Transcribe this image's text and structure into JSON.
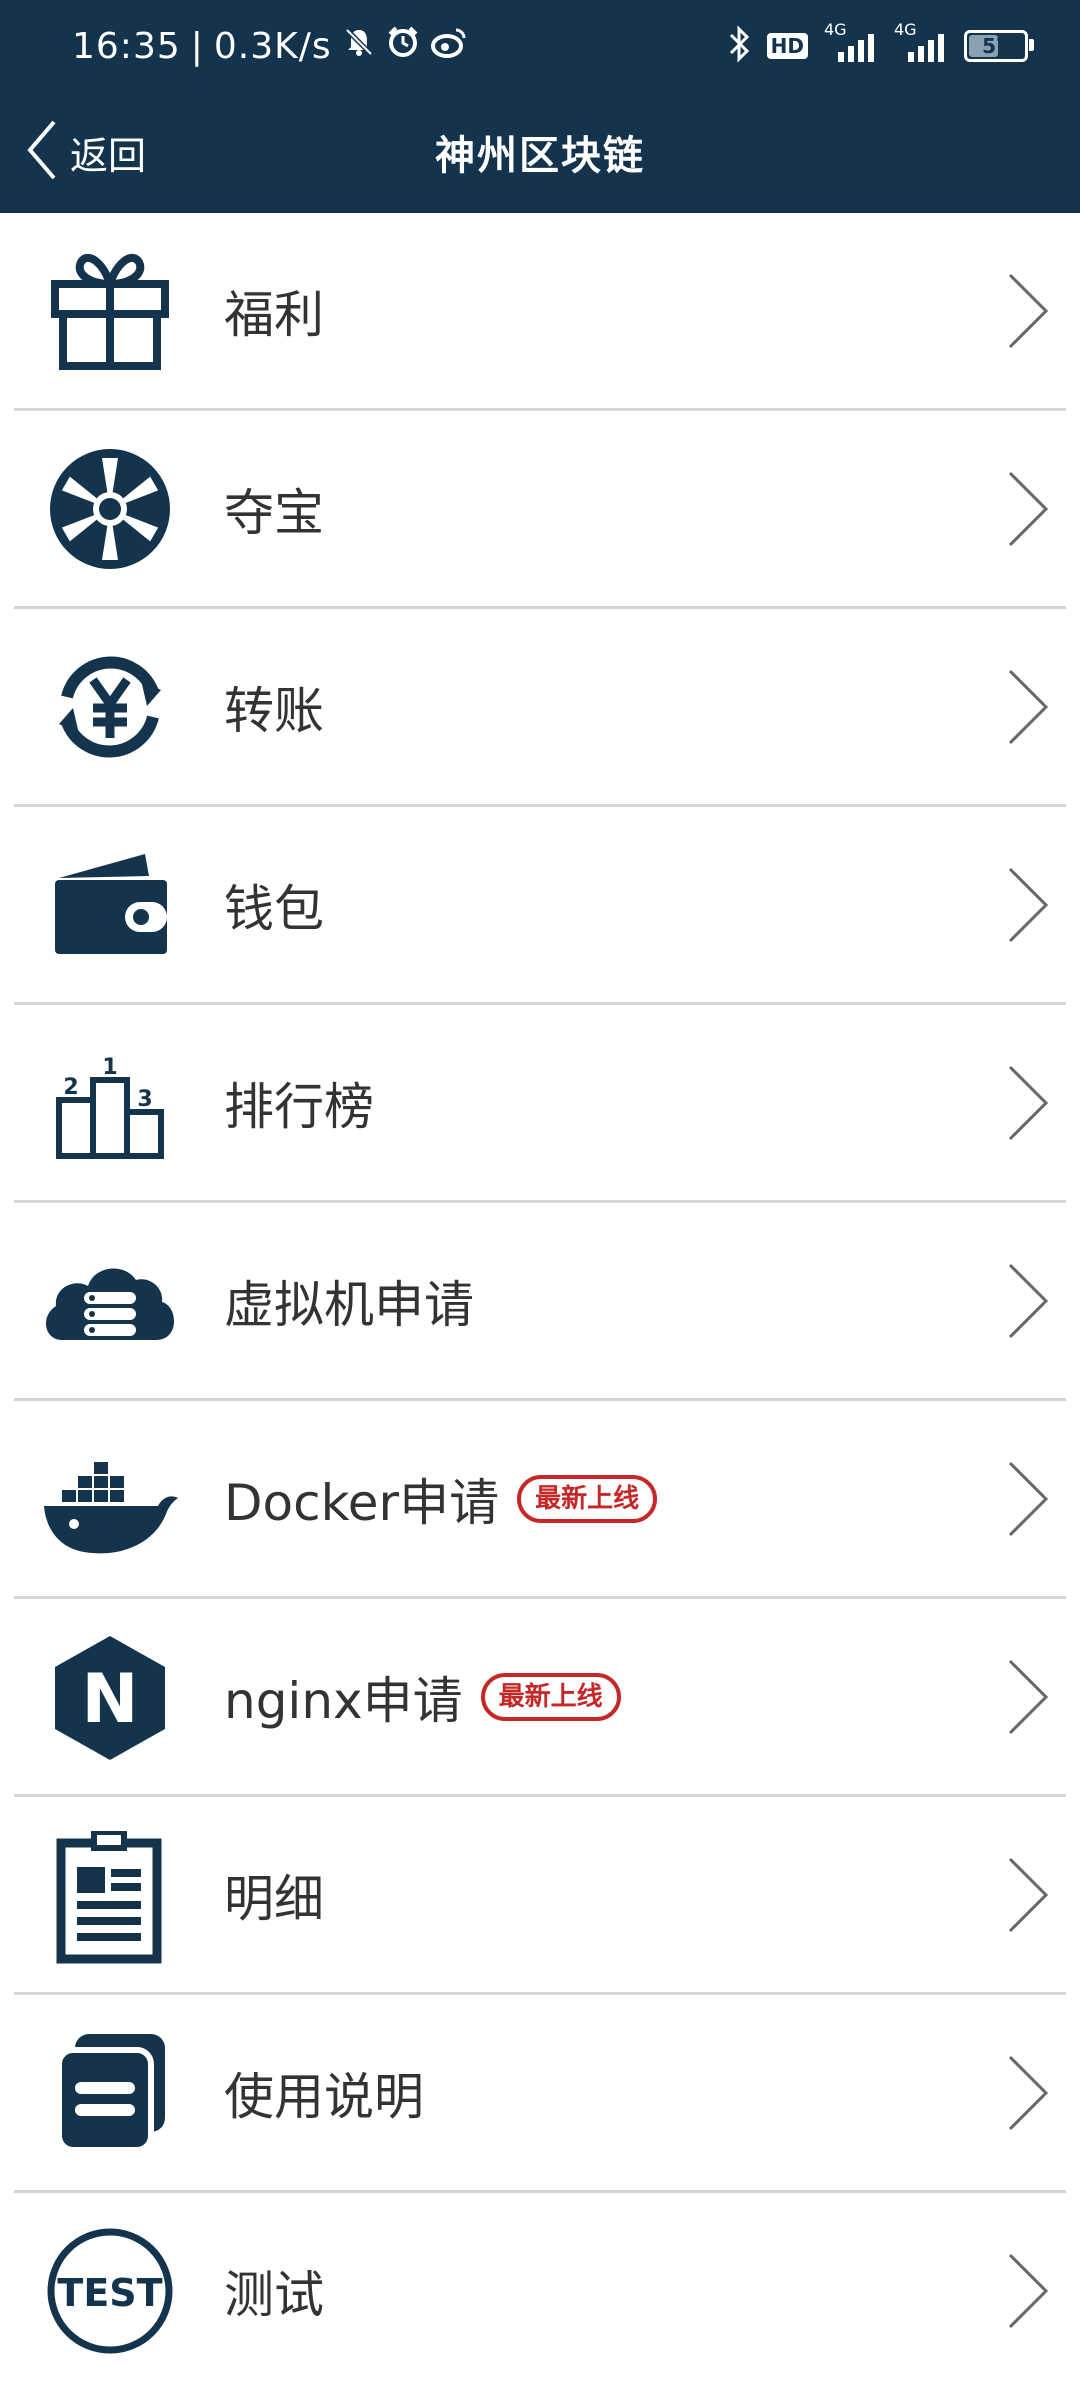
{
  "status_bar": {
    "time": "16:35",
    "speed": "0.3K/s",
    "left_icons": [
      "mute-icon",
      "alarm-icon",
      "weibo-icon"
    ],
    "network1": "4G",
    "network2": "4G",
    "hd": "HD",
    "battery": "57",
    "battery_level": 0.57
  },
  "header": {
    "back_label": "返回",
    "title": "神州区块链"
  },
  "colors": {
    "brand": "#14334d",
    "badge_red": "#c62828",
    "divider": "#d6d6d6"
  },
  "menu": [
    {
      "label": "福利",
      "icon": "gift-icon"
    },
    {
      "label": "夺宝",
      "icon": "wheel-icon"
    },
    {
      "label": "转账",
      "icon": "yen-transfer-icon"
    },
    {
      "label": "钱包",
      "icon": "wallet-icon"
    },
    {
      "label": "排行榜",
      "icon": "podium-icon",
      "podium": [
        "2",
        "1",
        "3"
      ]
    },
    {
      "label": "虚拟机申请",
      "icon": "cloud-server-icon"
    },
    {
      "label": "Docker申请",
      "icon": "docker-icon",
      "badge": "最新上线"
    },
    {
      "label": "nginx申请",
      "icon": "nginx-icon",
      "icon_text": "N",
      "badge": "最新上线"
    },
    {
      "label": "明细",
      "icon": "clipboard-icon"
    },
    {
      "label": "使用说明",
      "icon": "document-icon"
    },
    {
      "label": "测试",
      "icon": "test-icon",
      "icon_text": "TEST"
    }
  ]
}
